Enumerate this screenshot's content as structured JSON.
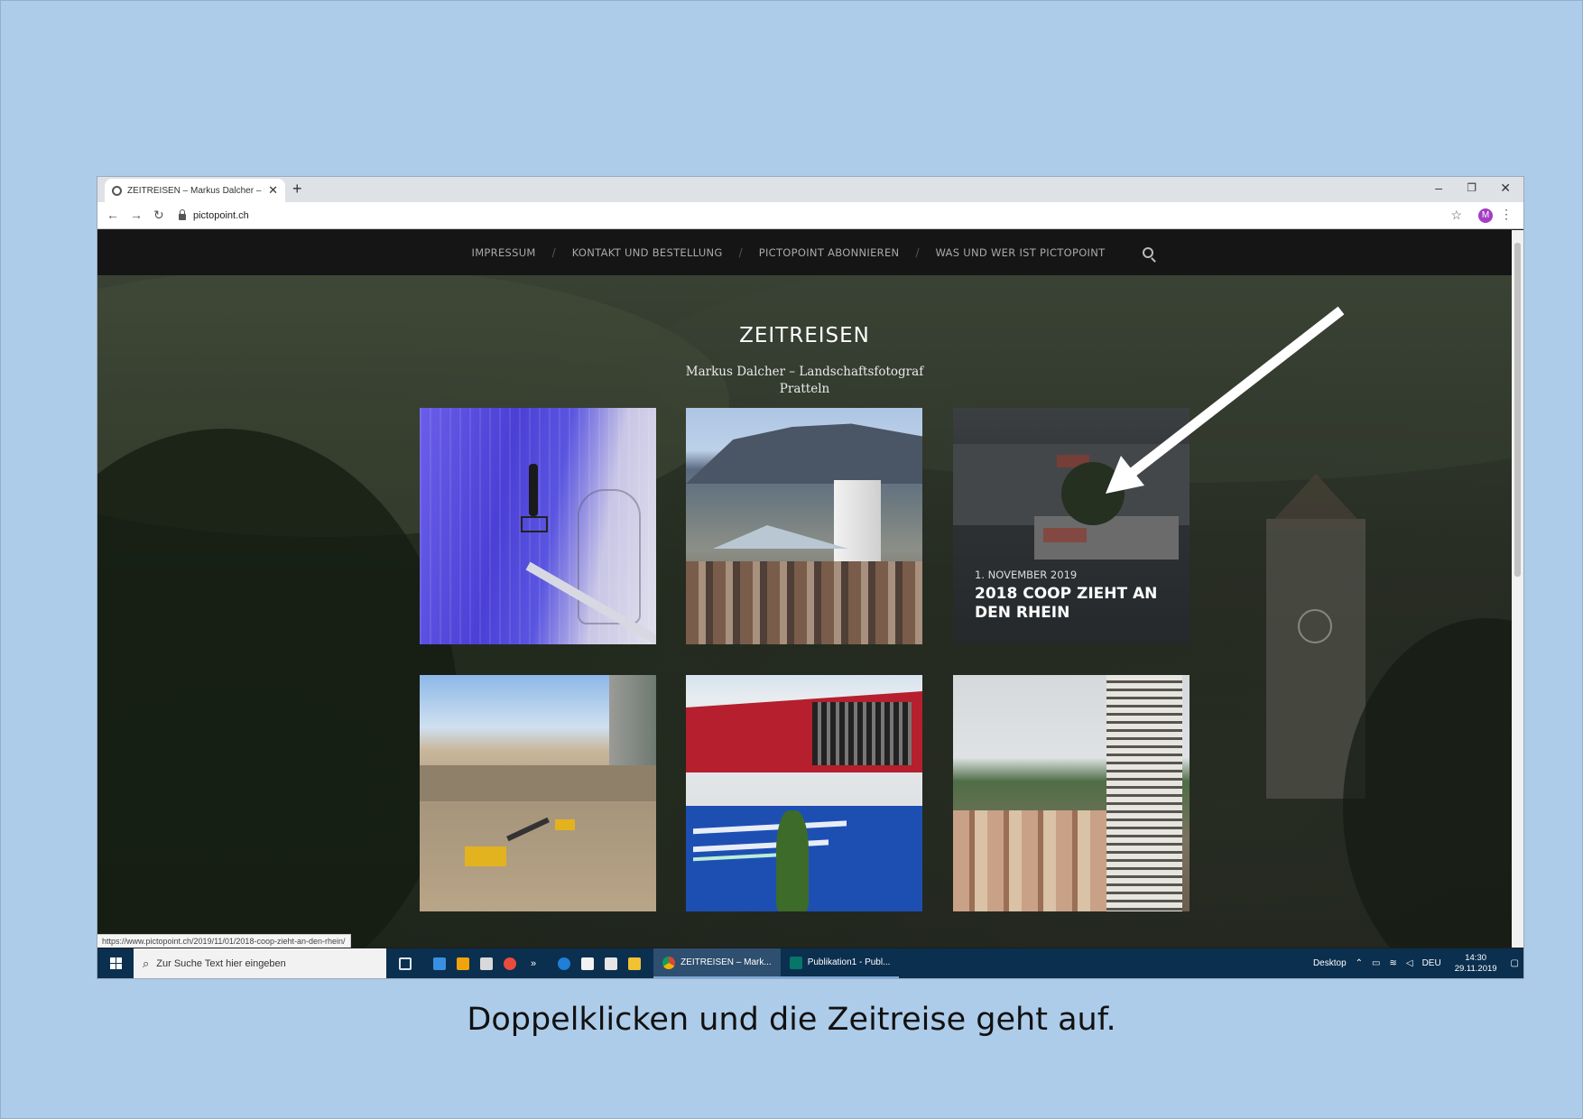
{
  "browser": {
    "tab_title": "ZEITREISEN – Markus Dalcher – L",
    "url": "pictopoint.ch",
    "avatar_letter": "M",
    "status_url": "https://www.pictopoint.ch/2019/11/01/2018-coop-zieht-an-den-rhein/"
  },
  "site": {
    "nav": [
      "IMPRESSUM",
      "KONTAKT UND BESTELLUNG",
      "PICTOPOINT ABONNIEREN",
      "WAS UND WER IST PICTOPOINT"
    ],
    "title": "ZEITREISEN",
    "subtitle_line1": "Markus Dalcher – Landschaftsfotograf",
    "subtitle_line2": "Pratteln",
    "hovered_post": {
      "date": "1. NOVEMBER 2019",
      "title": "2018 COOP ZIEHT AN DEN RHEIN"
    }
  },
  "taskbar": {
    "search_placeholder": "Zur Suche Text hier eingeben",
    "apps": [
      "ZEITREISEN – Mark...",
      "Publikation1 - Publ..."
    ],
    "desktop_label": "Desktop",
    "language": "DEU",
    "time": "14:30",
    "date": "29.11.2019"
  },
  "caption": "Doppelklicken und die Zeitreise geht auf.",
  "colors": {
    "slide_background": "#adcce9",
    "site_nav": "#151515",
    "taskbar": "#0b2f4f",
    "arrow": "#ffffff"
  }
}
